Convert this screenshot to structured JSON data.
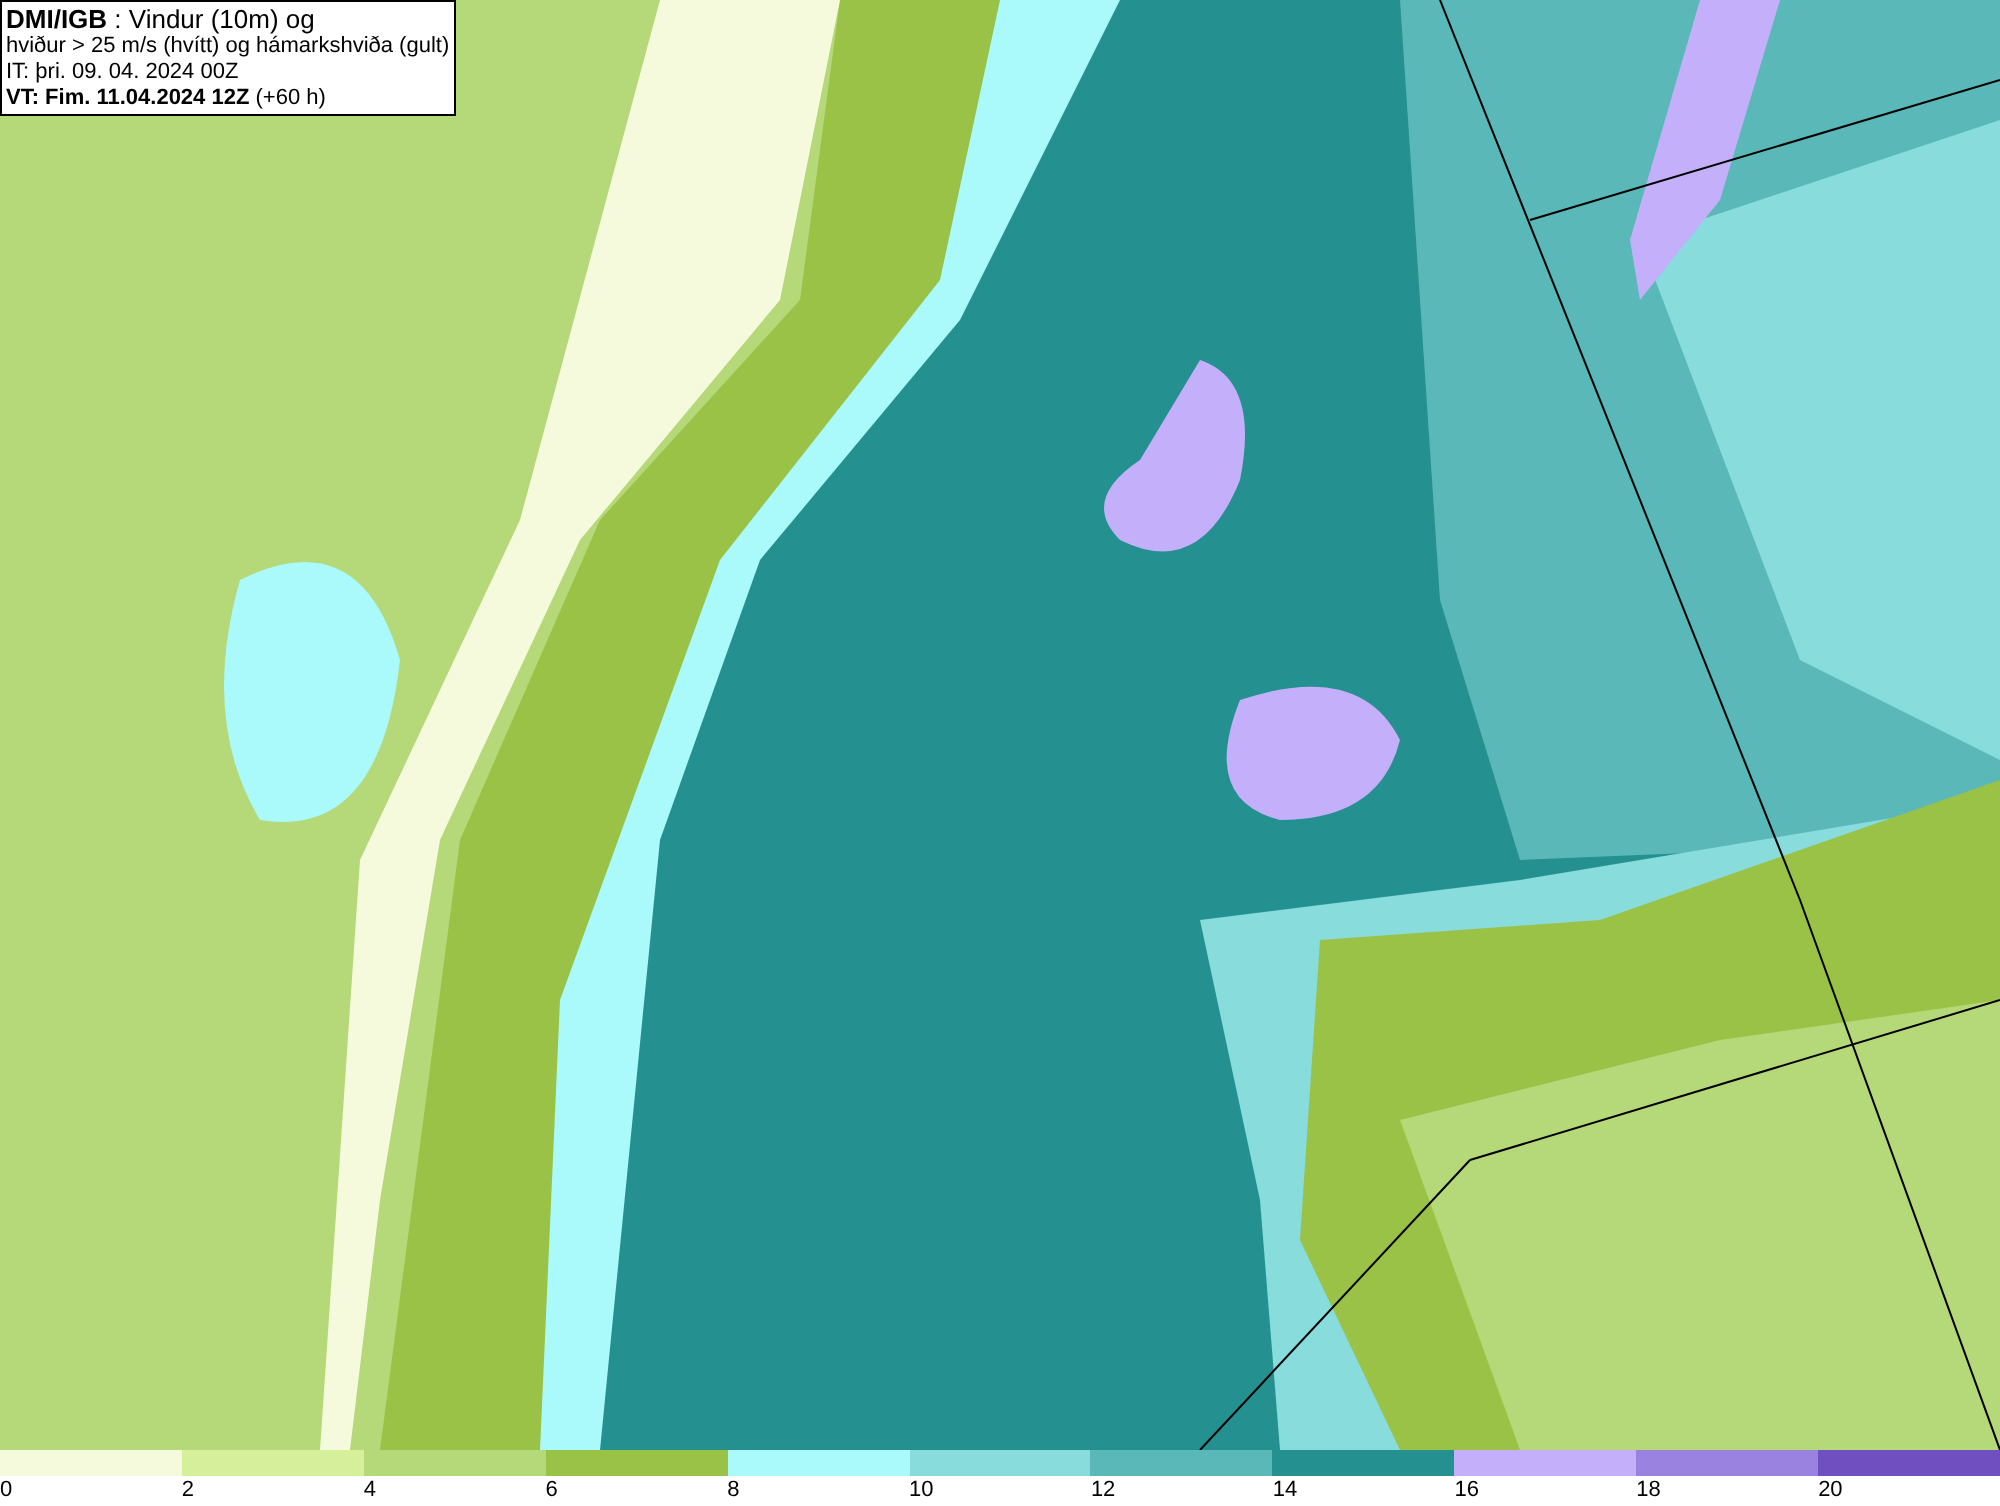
{
  "title_box": {
    "lines": [
      "**DMI/IGB** : Vindur (10m) og",
      "hviður > 25 m/s (hvítt) og hámarkshviða (gult)",
      "IT: þri. 09. 04. 2024 00Z",
      "**VT: Fim. 11.04.2024 12Z** (+60 h)"
    ]
  },
  "legend": {
    "bins": [
      {
        "label": "0",
        "color": "#f5fadc"
      },
      {
        "label": "2",
        "color": "#d6ef9a"
      },
      {
        "label": "4",
        "color": "#b5d878"
      },
      {
        "label": "6",
        "color": "#99c247"
      },
      {
        "label": "8",
        "color": "#aaf9fb"
      },
      {
        "label": "10",
        "color": "#88dcdc"
      },
      {
        "label": "12",
        "color": "#5ab8b8"
      },
      {
        "label": "14",
        "color": "#259090"
      },
      {
        "label": "16",
        "color": "#c4b0fa"
      },
      {
        "label": "18",
        "color": "#9a82e0"
      },
      {
        "label": "20",
        "color": "#7050c0"
      }
    ]
  }
}
